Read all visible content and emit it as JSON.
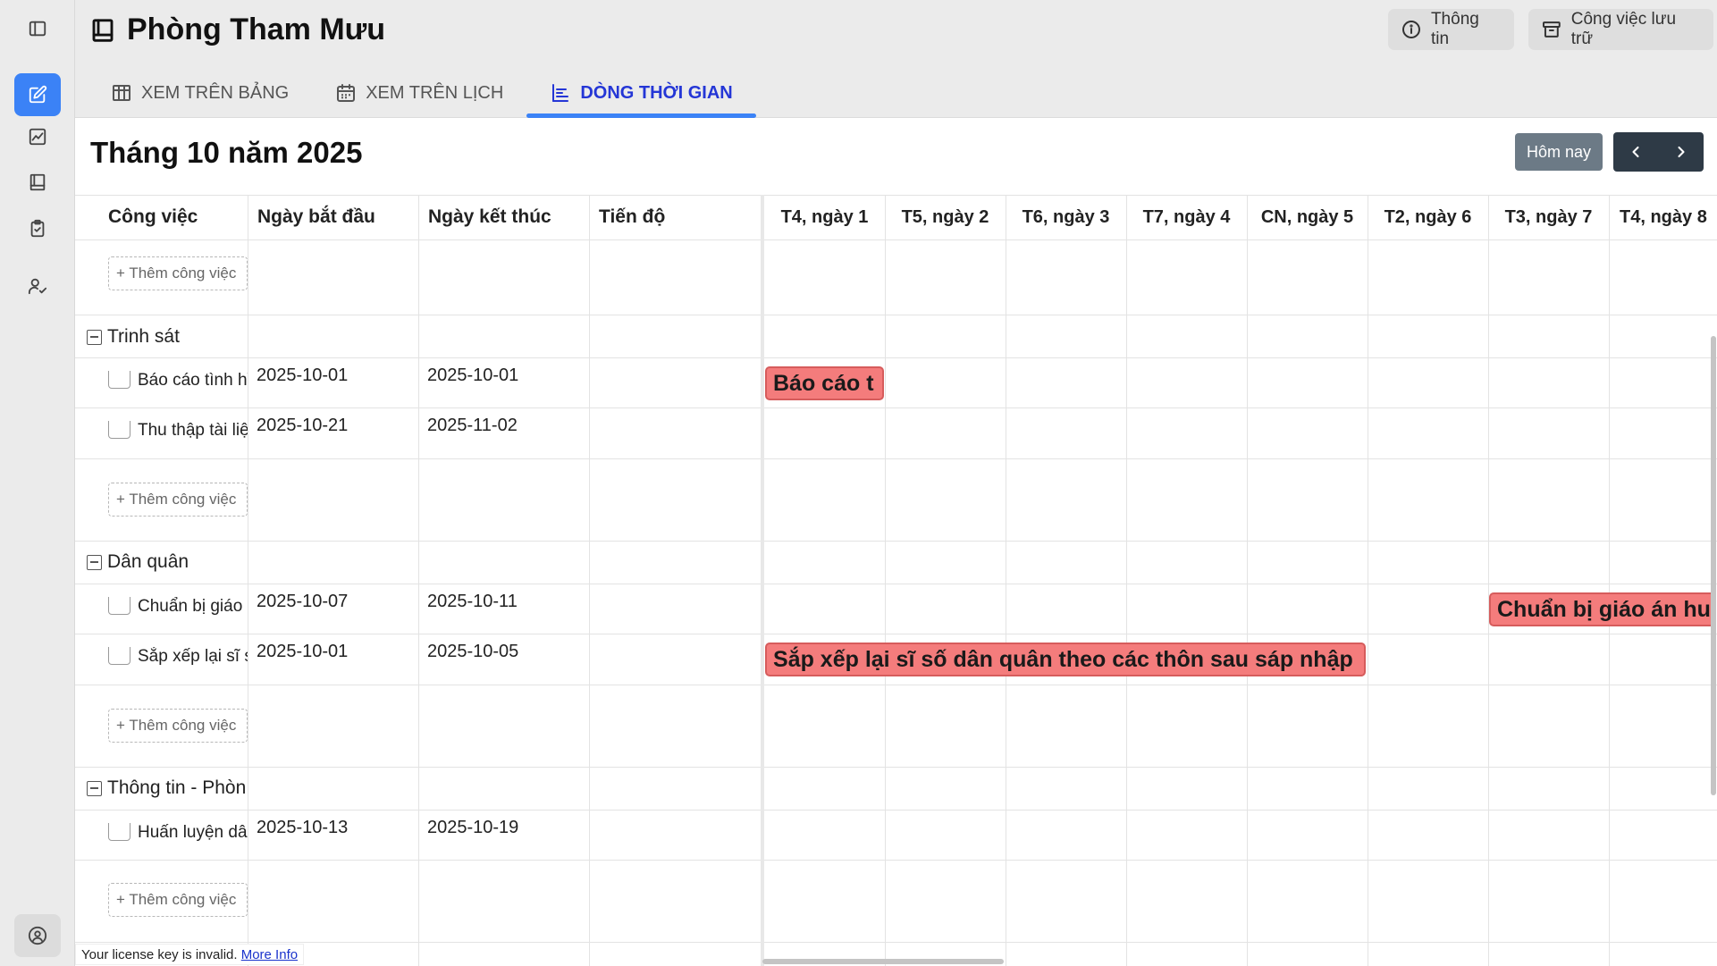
{
  "header": {
    "title": "Phòng Tham Mưu",
    "info_button": "Thông tin",
    "archive_button": "Công việc lưu trữ"
  },
  "tabs": [
    {
      "label": "XEM TRÊN BẢNG",
      "icon": "table-icon"
    },
    {
      "label": "XEM TRÊN LỊCH",
      "icon": "calendar-icon"
    },
    {
      "label": "DÒNG THỜI GIAN",
      "icon": "timeline-icon",
      "active": true
    }
  ],
  "toolbar": {
    "month_title": "Tháng 10 năm 2025",
    "today_button": "Hôm nay"
  },
  "columns": [
    "Công việc",
    "Ngày bắt đầu",
    "Ngày kết thúc",
    "Tiến độ"
  ],
  "days": [
    "T4, ngày 1",
    "T5, ngày 2",
    "T6, ngày 3",
    "T7, ngày 4",
    "CN, ngày 5",
    "T2, ngày 6",
    "T3, ngày 7",
    "T4, ngày 8"
  ],
  "add_task_label": "+ Thêm công việc",
  "groups": [
    {
      "name": "Trinh sát",
      "tasks": [
        {
          "name": "Báo cáo tình hình",
          "start": "2025-10-01",
          "end": "2025-10-01",
          "bar_label": "Báo cáo t"
        },
        {
          "name": "Thu thập tài liệu",
          "start": "2025-10-21",
          "end": "2025-11-02"
        }
      ]
    },
    {
      "name": "Dân quân",
      "tasks": [
        {
          "name": "Chuẩn bị giáo án",
          "start": "2025-10-07",
          "end": "2025-10-11",
          "bar_label": "Chuẩn bị giáo án hu"
        },
        {
          "name": "Sắp xếp lại sĩ số",
          "start": "2025-10-01",
          "end": "2025-10-05",
          "bar_label": "Sắp xếp lại sĩ số dân quân theo các thôn sau sáp nhập"
        }
      ]
    },
    {
      "name": "Thông tin - Phòng",
      "tasks": [
        {
          "name": "Huấn luyện dân quân",
          "start": "2025-10-13",
          "end": "2025-10-19"
        }
      ]
    }
  ],
  "license": {
    "text": "Your license key is invalid.",
    "link": "More Info"
  },
  "sidebar_icons": [
    "sidebar-toggle-icon",
    "edit-icon",
    "chart-icon",
    "book-icon",
    "clipboard-check-icon",
    "user-check-icon",
    "user-circle-icon"
  ],
  "colors": {
    "accent": "#3b82f6",
    "bar_fill": "#f47c7c",
    "bar_border": "#d65c5c",
    "nav_dark": "#2e3a46"
  }
}
